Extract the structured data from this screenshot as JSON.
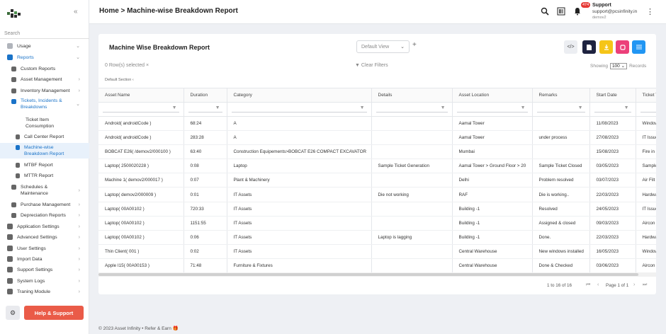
{
  "sidebar": {
    "search_label": "Search",
    "items": [
      {
        "label": "Usage",
        "has_chevron": true
      },
      {
        "label": "Reports",
        "has_chevron": true
      },
      {
        "label": "Custom Reports"
      },
      {
        "label": "Asset Management",
        "has_chevron": true
      },
      {
        "label": "Inventory Management",
        "has_chevron": true
      },
      {
        "label": "Tickets, Incidents & Breakdowns",
        "has_chevron": true
      },
      {
        "label": "Ticket Item Consumption"
      },
      {
        "label": "Call Center Report"
      },
      {
        "label": "Machine-wise Breakdown Report"
      },
      {
        "label": "MTBF Report"
      },
      {
        "label": "MTTR Report"
      },
      {
        "label": "Schedules & Maintenance",
        "has_chevron": true
      },
      {
        "label": "Purchase Management",
        "has_chevron": true
      },
      {
        "label": "Depreciation Reports",
        "has_chevron": true
      },
      {
        "label": "Application Settings",
        "has_chevron": true
      },
      {
        "label": "Advanced Settings",
        "has_chevron": true
      },
      {
        "label": "User Settings",
        "has_chevron": true
      },
      {
        "label": "Import Data",
        "has_chevron": true
      },
      {
        "label": "Support Settings",
        "has_chevron": true
      },
      {
        "label": "System Logs",
        "has_chevron": true
      },
      {
        "label": "Traning Module",
        "has_chevron": true
      }
    ],
    "help_label": "Help & Support",
    "collapse_icon": "«"
  },
  "header": {
    "breadcrumb": "Home > Machine-wise Breakdown Report",
    "notification_count": "474",
    "user_name": "Support",
    "user_email": "support@pcsinfinity.in",
    "user_org": "demov2"
  },
  "report": {
    "title": "Machine Wise Breakdown Report",
    "view_select": "Default View",
    "plus": "+",
    "rows_selected": "0  Row(s) selected",
    "rows_selected_clear": "×",
    "clear_filters": "Clear Filters",
    "showing_label": "Showing",
    "showing_value": "100",
    "showing_suffix": "Records",
    "default_section": "Default Section",
    "toolbar_colors": {
      "code": "#eceef2",
      "doc": "#1e2340",
      "download": "#f5c518",
      "refresh": "#ec407a",
      "settings": "#2196f3"
    }
  },
  "table": {
    "columns": [
      "Asset Name",
      "Duration",
      "Category",
      "Details",
      "Asset Location",
      "Remarks",
      "Start Date",
      "Ticket Type"
    ],
    "rows": [
      [
        "Android( androidCode )",
        "68:24",
        "A",
        "",
        "Aamal Tower",
        "",
        "11/08/2023",
        "Window"
      ],
      [
        "Android( androidCode )",
        "283:28",
        "A",
        "",
        "Aamal Tower",
        "under process",
        "27/08/2023",
        "IT Issue"
      ],
      [
        "BOBCAT E26( /demov2/000100 )",
        "63:40",
        "Construction Equipements>BOBCAT E26 COMPACT EXCAVATOR",
        "",
        "Mumbai",
        "",
        "15/08/2023",
        "Fire in"
      ],
      [
        "Laptop( 2500020228 )",
        "0:08",
        "Laptop",
        "Sample Ticket Generation",
        "Aamal Tower > Ground Floor > 20",
        "Sample Ticket Closed",
        "03/05/2023",
        "Sample"
      ],
      [
        "Machine 1( demov2/000017 )",
        "0:07",
        "Plant & Machinery",
        "",
        "Delhi",
        "Problem resolved",
        "03/07/2023",
        "Air Filt"
      ],
      [
        "Laptop( demov2/000009 )",
        "0:01",
        "IT Assets",
        "Die not working",
        "RAF",
        "Die is working..",
        "22/03/2023",
        "Hardwa"
      ],
      [
        "Laptop( 00A00102 )",
        "720:33",
        "IT Assets",
        "",
        "Building -1",
        "Resolved",
        "24/05/2023",
        "IT Issue"
      ],
      [
        "Laptop( 00A00102 )",
        "1151:55",
        "IT Assets",
        "",
        "Building -1",
        "Assigned & closed",
        "09/03/2023",
        "Aircon"
      ],
      [
        "Laptop( 00A00102 )",
        "0:06",
        "IT Assets",
        "Laptop is lagging",
        "Building -1",
        "Done.",
        "22/03/2023",
        "Hardwa"
      ],
      [
        "Thin Client( 001 )",
        "0:02",
        "IT Assets",
        "",
        "Central Warehouse",
        "New windows installed",
        "16/05/2023",
        "Window"
      ],
      [
        "Apple I15( 00A00153 )",
        "71:48",
        "Furniture & Fixtures",
        "",
        "Central Warehouse",
        "Done & Checked",
        "03/06/2023",
        "Aircon"
      ]
    ]
  },
  "pagination": {
    "range": "1 to 16 of 16",
    "page_label": "Page 1 of 1"
  },
  "footer": {
    "text": "© 2023  Asset Infinity • Refer & Earn"
  }
}
